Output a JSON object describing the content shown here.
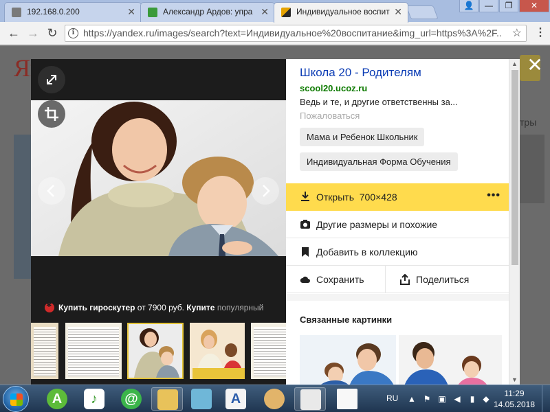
{
  "browser": {
    "tabs": [
      {
        "title": "192.168.0.200",
        "favicon_color": "#7a7a7a",
        "active": false
      },
      {
        "title": "Александр Ардов: упра",
        "favicon_color": "#3a9a3a",
        "active": false
      },
      {
        "title": "Индивидуальное воспит",
        "favicon_color": "#e6a300",
        "active": true
      }
    ],
    "url": "https://yandex.ru/images/search?text=Индивидуальное%20воспитание&img_url=https%3A%2F...",
    "window_buttons": {
      "minimize": "—",
      "maximize": "❐",
      "close": "✕"
    }
  },
  "background_page": {
    "logo": "Ян",
    "side_text": "тры"
  },
  "viewer": {
    "promo": {
      "bold": "Купить гироскутер",
      "mid": " от 7900 руб. ",
      "bold2": "Купите",
      "rest": " популярный"
    },
    "thumbnails": [
      {
        "kind": "document"
      },
      {
        "kind": "document"
      },
      {
        "kind": "photo",
        "selected": true
      },
      {
        "kind": "photo"
      },
      {
        "kind": "document"
      }
    ]
  },
  "panel": {
    "site_title": "Школа 20 - Родителям",
    "site_url": "scool20.ucoz.ru",
    "description": "Ведь и те, и другие ответственны за...",
    "complain": "Пожаловаться",
    "tags": [
      "Мама и Ребенок Школьник",
      "Индивидуальная Форма Обучения"
    ],
    "open_label": "Открыть",
    "open_size": "700×428",
    "more": "•••",
    "other_sizes": "Другие размеры и похожие",
    "add_collection": "Добавить в коллекцию",
    "save": "Сохранить",
    "share": "Поделиться",
    "related_title": "Связанные картинки"
  },
  "taskbar": {
    "language": "RU",
    "time": "11:29",
    "date": "14.05.2018"
  },
  "colors": {
    "accent_yellow": "#ffdb4d",
    "link_blue": "#0a3bb4",
    "url_green": "#0d7a00"
  }
}
